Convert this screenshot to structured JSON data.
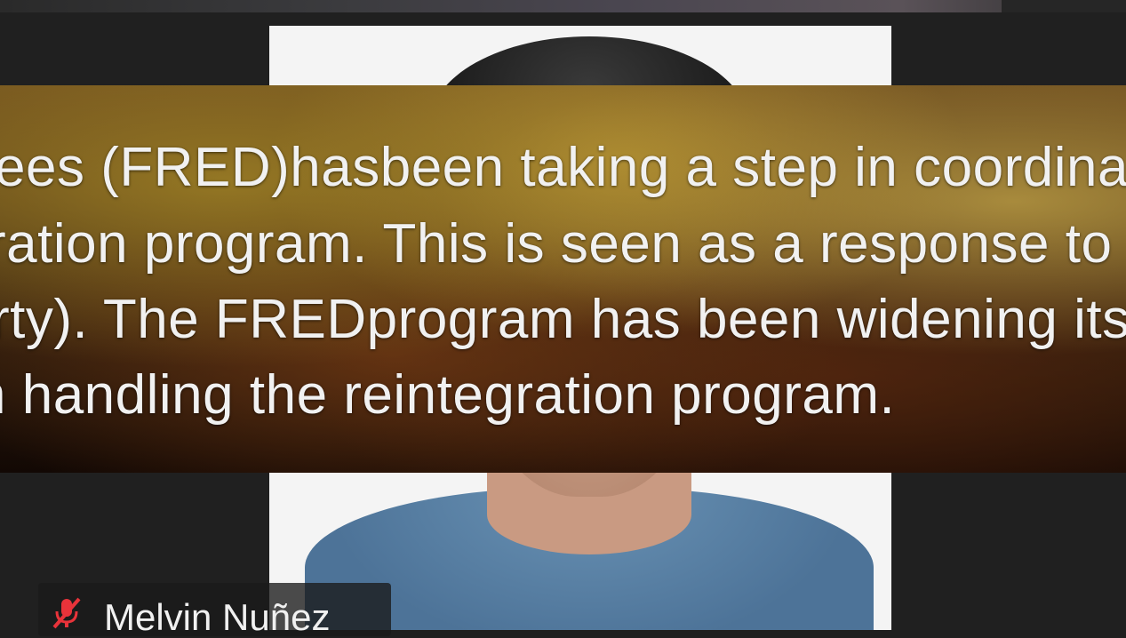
{
  "caption": {
    "lines": [
      "ees (FRED)hasbeen taking a step in coordinat",
      "ration program. This is seen as a response to",
      "rty). The FREDprogram  has been widening its",
      "n handling the reintegration program."
    ]
  },
  "participant": {
    "name": "Melvin Nuñez",
    "muted_icon": "mic-muted-icon",
    "muted_color": "#e8333a"
  }
}
